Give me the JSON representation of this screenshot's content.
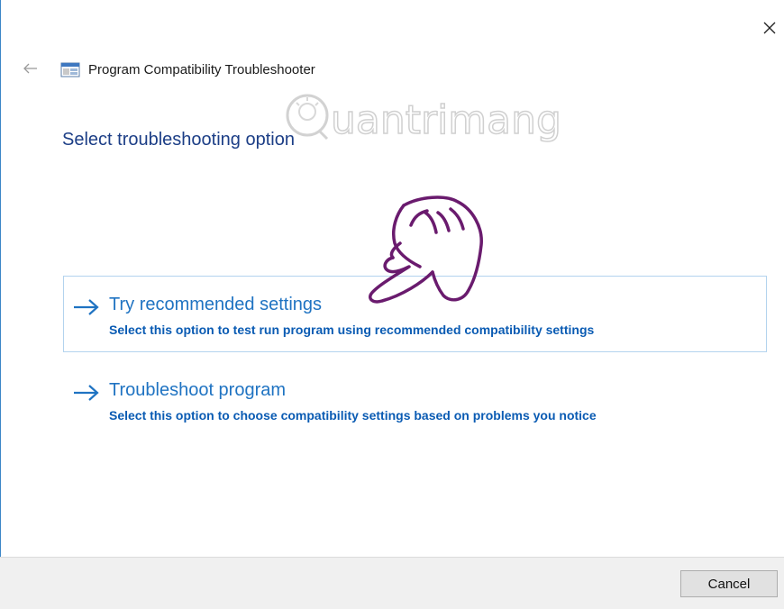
{
  "window": {
    "title": "Program Compatibility Troubleshooter",
    "close_icon": "close-icon",
    "back_icon": "back-arrow-icon",
    "app_icon": "troubleshooter-app-icon"
  },
  "watermark": {
    "text": "Quantrimang"
  },
  "main": {
    "heading": "Select troubleshooting option",
    "options": [
      {
        "title": "Try recommended settings",
        "description": "Select this option to test run program using recommended compatibility settings",
        "icon": "arrow-right-icon",
        "selected": true
      },
      {
        "title": "Troubleshoot program",
        "description": "Select this option to choose compatibility settings based on problems you notice",
        "icon": "arrow-right-icon",
        "selected": false
      }
    ]
  },
  "footer": {
    "cancel_label": "Cancel"
  },
  "colors": {
    "heading": "#1c3e86",
    "link": "#1f73c2",
    "selection_border": "#b3d3ee",
    "window_border": "#3c86c7",
    "hand": "#6a1b6e"
  }
}
